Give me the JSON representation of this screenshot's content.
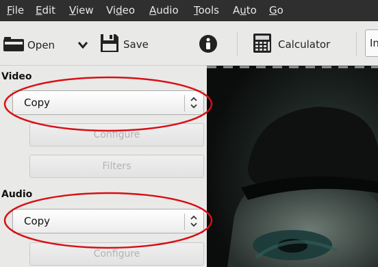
{
  "menu": [
    {
      "label": "File",
      "mnemonic": "F",
      "rest": "ile"
    },
    {
      "label": "Edit",
      "mnemonic": "E",
      "rest": "dit"
    },
    {
      "label": "View",
      "mnemonic": "V",
      "rest": "iew"
    },
    {
      "label": "Video",
      "pre": "Vi",
      "mnemonic": "d",
      "post": "eo"
    },
    {
      "label": "Audio",
      "mnemonic": "A",
      "rest": "udio"
    },
    {
      "label": "Tools",
      "mnemonic": "T",
      "rest": "ools"
    },
    {
      "label": "Auto",
      "pre": "A",
      "mnemonic": "u",
      "post": "to"
    },
    {
      "label": "Go",
      "mnemonic": "G",
      "rest": "o"
    }
  ],
  "toolbar": {
    "open_label": "Open",
    "save_label": "Save",
    "calculator_label": "Calculator",
    "truncated_label": "In"
  },
  "video_section": {
    "title": "Video",
    "codec_value": "Copy",
    "configure_label": "Configure",
    "filters_label": "Filters"
  },
  "audio_section": {
    "title": "Audio",
    "codec_value": "Copy",
    "configure_label": "Configure"
  },
  "colors": {
    "menubar_bg": "#2f2f2f",
    "annotation": "#d80f14"
  }
}
